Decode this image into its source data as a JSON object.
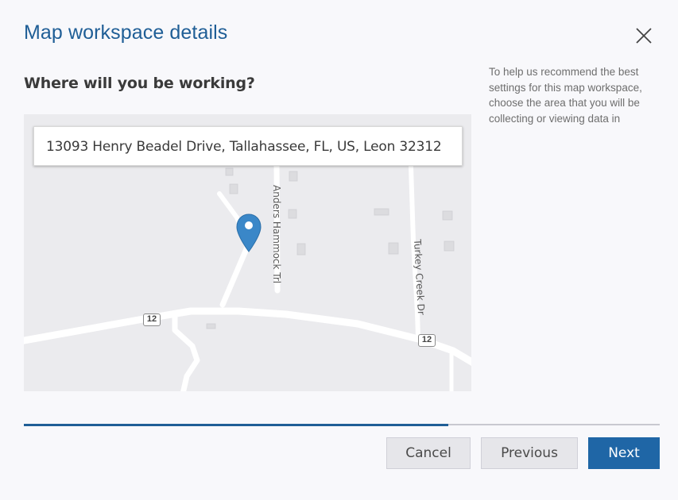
{
  "dialog": {
    "title": "Map workspace details",
    "close_label": "Close"
  },
  "question": "Where will you be working?",
  "help_text": "To help us recommend the best settings for this map workspace, choose the area that you will be collecting or viewing data in",
  "map": {
    "address": "13093 Henry Beadel Drive, Tallahassee, FL, US, Leon 32312",
    "roads": [
      "Anders Hammock Trl",
      "Turkey Creek Dr"
    ],
    "route_shields": [
      "12",
      "12"
    ],
    "pin_color": "#3a87c8"
  },
  "progress": {
    "fraction": 0.667
  },
  "buttons": {
    "cancel": "Cancel",
    "previous": "Previous",
    "next": "Next"
  },
  "colors": {
    "accent": "#1f5e96",
    "primary_button": "#1f66a6"
  }
}
